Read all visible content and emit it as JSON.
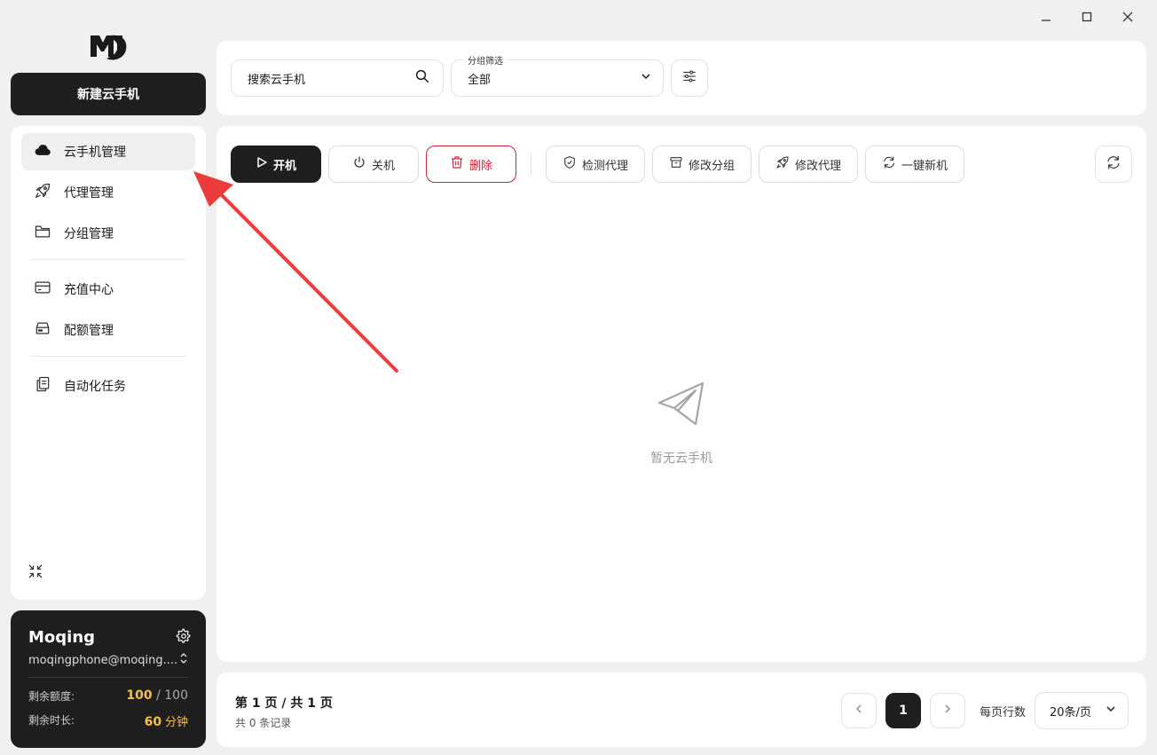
{
  "window": {
    "controls": [
      "minimize-icon",
      "maximize-icon",
      "close-icon"
    ]
  },
  "brand": {
    "logo": "app-logo"
  },
  "sidebar": {
    "new_button": "新建云手机",
    "items": [
      {
        "label": "云手机管理",
        "icon": "cloud-icon",
        "active": true
      },
      {
        "label": "代理管理",
        "icon": "rocket-icon"
      },
      {
        "label": "分组管理",
        "icon": "folder-icon"
      },
      {
        "label": "充值中心",
        "icon": "credit-card-icon"
      },
      {
        "label": "配额管理",
        "icon": "server-icon"
      },
      {
        "label": "自动化任务",
        "icon": "clipboard-icon"
      }
    ],
    "collapse_icon": "collapse-icon"
  },
  "account": {
    "name": "Moqing",
    "email": "moqingphone@moqing....",
    "quota_label": "剩余额度:",
    "quota_used": "100",
    "quota_sep": " / ",
    "quota_total": "100",
    "time_label": "剩余时长:",
    "time_value": "60",
    "time_unit": "分钟"
  },
  "search": {
    "placeholder": "搜索云手机"
  },
  "group_filter": {
    "label": "分组筛选",
    "value": "全部"
  },
  "toolbar": {
    "start": "开机",
    "shutdown": "关机",
    "delete": "删除",
    "check_proxy": "检测代理",
    "edit_group": "修改分组",
    "edit_proxy": "修改代理",
    "one_click_new": "一键新机"
  },
  "empty": {
    "text": "暂无云手机"
  },
  "pagination": {
    "page_info": "第 1 页 / 共 1 页",
    "total": "共 0 条记录",
    "current_page": "1",
    "rows_label": "每页行数",
    "rows_value": "20条/页"
  },
  "colors": {
    "accent": "#1f1f1f",
    "danger": "#c8283b",
    "gold": "#f2c14e",
    "annotation_arrow": "#ee3b3b"
  }
}
